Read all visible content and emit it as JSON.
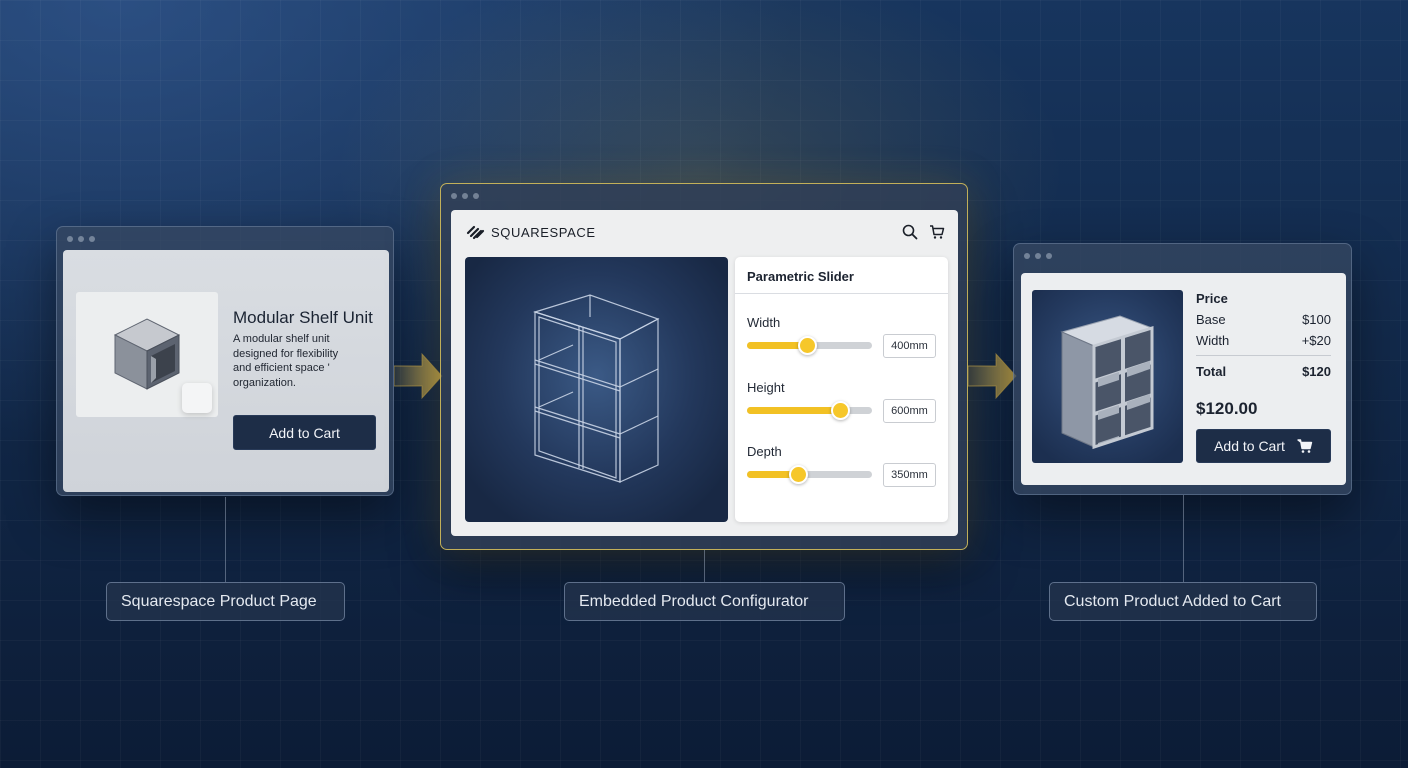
{
  "left_window": {
    "product_title": "Modular Shelf Unit",
    "product_description": "A modular shelf unit designed for flexibility and efficient space ' organization.",
    "add_to_cart_label": "Add to Cart",
    "icons": [
      "cube-icon"
    ]
  },
  "center_window": {
    "brand": "SQUARESPACE",
    "header_icons": [
      "search-icon",
      "cart-icon"
    ],
    "slider_panel_title": "Parametric Slider",
    "sliders": [
      {
        "label": "Width",
        "value": "400mm",
        "level": 0.48
      },
      {
        "label": "Height",
        "value": "600mm",
        "level": 0.74
      },
      {
        "label": "Depth",
        "value": "350mm",
        "level": 0.41
      }
    ],
    "accent_color": "#f2c124"
  },
  "right_window": {
    "price_heading": "Price",
    "lines": [
      {
        "label": "Base",
        "value": "$100"
      },
      {
        "label": "Width",
        "value": "+$20"
      }
    ],
    "total_label": "Total",
    "total_value": "$120",
    "big_price": "$120.00",
    "add_to_cart_label": "Add to Cart",
    "icons": [
      "cart-icon"
    ]
  },
  "captions": {
    "left": "Squarespace Product Page",
    "center": "Embedded Product Configurator",
    "right": "Custom Product Added to Cart"
  },
  "colors": {
    "highlight_border": "#dcc45a",
    "button_dark": "#1d2d47"
  }
}
